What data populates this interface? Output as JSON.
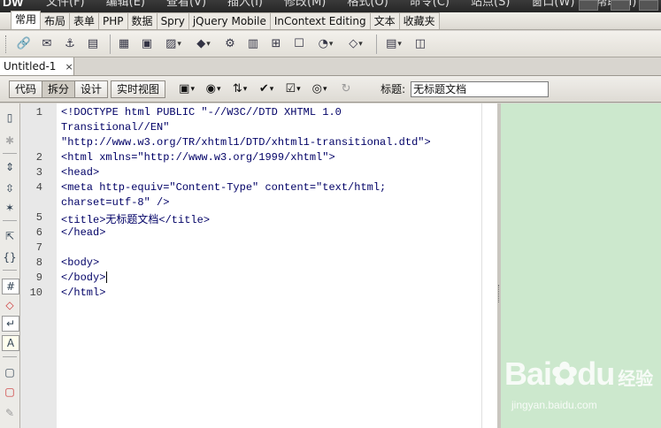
{
  "app": {
    "logo": "DW"
  },
  "menubar": {
    "items": [
      "文件(F)",
      "编辑(E)",
      "查看(V)",
      "插入(I)",
      "修改(M)",
      "格式(O)",
      "命令(C)",
      "站点(S)",
      "窗口(W)",
      "帮助(H)"
    ]
  },
  "insert_categories": {
    "tabs": [
      "常用",
      "布局",
      "表单",
      "PHP",
      "数据",
      "Spry",
      "jQuery Mobile",
      "InContext Editing",
      "文本",
      "收藏夹"
    ],
    "active": "常用"
  },
  "insert_toolbar": {
    "buttons": [
      "hyperlink-icon",
      "email-link-icon",
      "named-anchor-icon",
      "horizontal-rule-icon",
      "table-icon",
      "insert-div-icon",
      "images-icon",
      "media-icon",
      "widget-icon",
      "date-icon",
      "server-side-include-icon",
      "comment-icon",
      "head-icon",
      "script-icon",
      "templates-icon",
      "tag-chooser-icon"
    ]
  },
  "document_tab": {
    "title": "Untitled-1",
    "close": "×"
  },
  "doc_toolbar": {
    "views": [
      "代码",
      "拆分",
      "设计",
      "实时视图"
    ],
    "active_view": "拆分",
    "title_label": "标题:",
    "title_value": "无标题文档"
  },
  "code": {
    "line_numbers": [
      "1",
      "2",
      "3",
      "4",
      "5",
      "6",
      "7",
      "8",
      "9",
      "10"
    ],
    "lines": [
      "<!DOCTYPE html PUBLIC \"-//W3C//DTD XHTML 1.0",
      "Transitional//EN\"",
      "\"http://www.w3.org/TR/xhtml1/DTD/xhtml1-transitional.dtd\">",
      "<html xmlns=\"http://www.w3.org/1999/xhtml\">",
      "<head>",
      "<meta http-equiv=\"Content-Type\" content=\"text/html;",
      "charset=utf-8\" />",
      "<title>无标题文档</title>",
      "</head>",
      "",
      "<body>",
      "</body>",
      "</html>"
    ]
  },
  "watermark": {
    "brand": "Bai",
    "brand2": "du",
    "cn": "经验",
    "url": "jingyan.baidu.com"
  },
  "colors": {
    "design_view_bg": "#cce8cd",
    "code_text": "#000066"
  }
}
